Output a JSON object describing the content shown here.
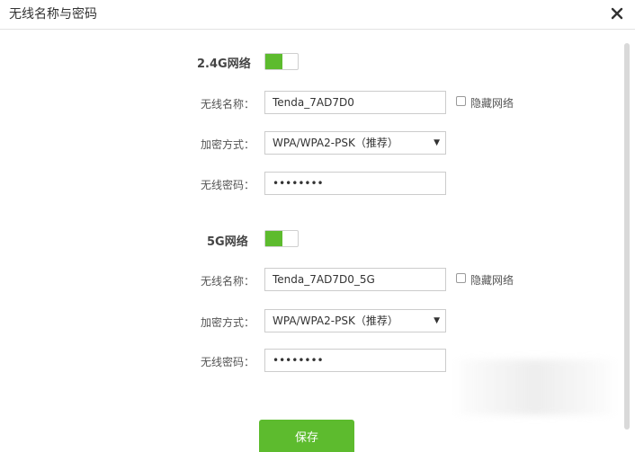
{
  "dialog": {
    "title": "无线名称与密码"
  },
  "sections": [
    {
      "label": "2.4G网络",
      "enabled": true,
      "ssid_label": "无线名称：",
      "ssid_value": "Tenda_7AD7D0",
      "hide_label": "隐藏网络",
      "encryption_label": "加密方式：",
      "encryption_value": "WPA/WPA2-PSK（推荐）",
      "password_label": "无线密码：",
      "password_mask": "••••••••"
    },
    {
      "label": "5G网络",
      "enabled": true,
      "ssid_label": "无线名称：",
      "ssid_value": "Tenda_7AD7D0_5G",
      "hide_label": "隐藏网络",
      "encryption_label": "加密方式：",
      "encryption_value": "WPA/WPA2-PSK（推荐）",
      "password_label": "无线密码：",
      "password_mask": "••••••••"
    }
  ],
  "actions": {
    "save_label": "保存"
  },
  "colors": {
    "accent": "#5dbb2e"
  },
  "icons": {
    "close": "close-icon",
    "dropdown": "chevron-down-icon"
  }
}
